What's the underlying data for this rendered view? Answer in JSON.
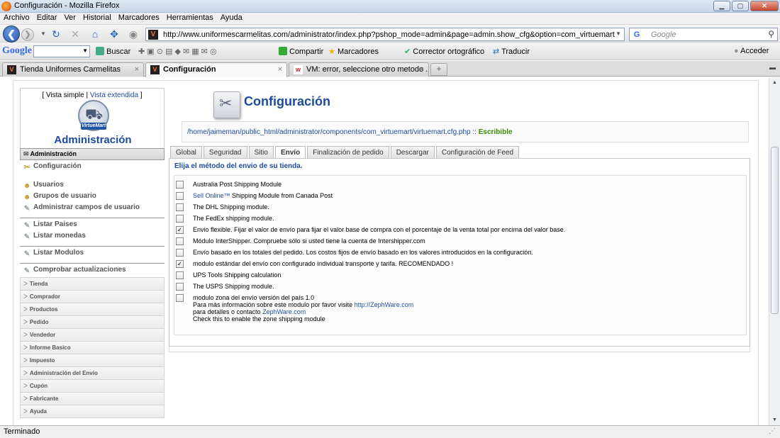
{
  "window": {
    "title": "Configuración - Mozilla Firefox",
    "min": "▁",
    "max": "▢",
    "close": "✕"
  },
  "menu": [
    "Archivo",
    "Editar",
    "Ver",
    "Historial",
    "Marcadores",
    "Herramientas",
    "Ayuda"
  ],
  "nav": {
    "url": "http://www.uniformescarmelitas.com/administrator/index.php?pshop_mode=admin&page=admin.show_cfg&option=com_virtuemart",
    "search_placeholder": "Google"
  },
  "google_toolbar": {
    "logo": "Google",
    "items": [
      "Buscar",
      "Compartir",
      "Marcadores",
      "Corrector ortográfico",
      "Traducir",
      "Acceder"
    ]
  },
  "tabs": [
    {
      "label": "Tienda Uniformes Carmelitas",
      "active": false
    },
    {
      "label": "Configuración",
      "active": true
    },
    {
      "label": "VM: error, seleccione otro metodo ...",
      "active": false
    }
  ],
  "sidebar": {
    "view_simple": "[ Vista simple |",
    "view_extended": "Vista extendida",
    "view_close": "]",
    "logo_band": "VirtueMart",
    "title": "Administración",
    "header": "Administración",
    "links": {
      "config": "Configuración",
      "users": "Usuarios",
      "user_groups": "Grupos de usuario",
      "user_fields": "Administrar campos de usuario",
      "countries": "Listar Paises",
      "currencies": "Listar monedas",
      "modules": "Listar Modulos",
      "updates": "Comprobar actualizaciones"
    },
    "categories": [
      "Tienda",
      "Comprador",
      "Productos",
      "Pedido",
      "Vendedor",
      "Informe Basico",
      "Impuesto",
      "Administración del Envío",
      "Cupón",
      "Fabricante",
      "Ayuda"
    ]
  },
  "main": {
    "title": "Configuración",
    "path": "/home/jaimeman/public_html/administrator/components/com_virtuemart/virtuemart.cfg.php",
    "path_sep": "::",
    "writable": "Escribible",
    "tabs": [
      "Global",
      "Seguridad",
      "Sitio",
      "Envío",
      "Finalización de pedido",
      "Descargar",
      "Configuración de Feed"
    ],
    "panel_heading": "Elija el método del envio de su tienda.",
    "options": {
      "o1": "Australia Post Shipping Module",
      "o2_link": "Sell Online™",
      "o2": " Shipping Module from Canada Post",
      "o3": "The DHL Shipping module.",
      "o4": "The FedEx shipping module.",
      "o5": "Envio flexible. Fijar el valor de envío para fijar el valor base de compra con el porcentaje de la venta total por encima del valor base.",
      "o6": "Módulo InterShipper. Compruebe sólo si usted tiene la cuenta de Intershipper.com",
      "o7": "Envío basado en los totales del pedido. Los costos fijos de envío basado en los valores introducidos en la configuración.",
      "o8": "modulo estándar del envío con configurado individual transporte y tarifa. RECOMENDADO !",
      "o9": "UPS Tools Shipping calculation",
      "o10": "The USPS Shipping module.",
      "o11_line1": "modulo zona del envío versión del país 1.0",
      "o11_line2": "Para más información sobre este modulo por favor visite ",
      "o11_link1": "http://ZephWare.com",
      "o11_line3": "para detalles o contacto ",
      "o11_link2": "ZephWare.com",
      "o11_line4": "Check this to enable the zone shipping module"
    },
    "checked": [
      "o5",
      "o8"
    ]
  },
  "status": "Terminado"
}
